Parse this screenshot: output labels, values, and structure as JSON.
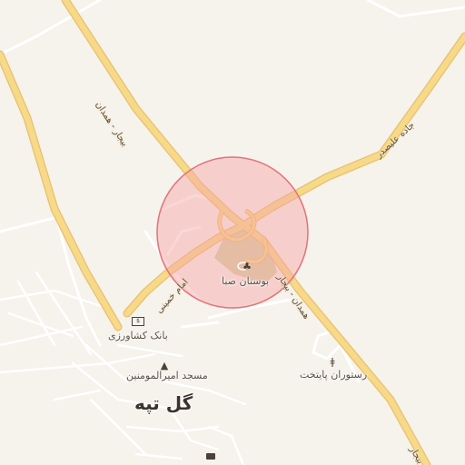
{
  "map": {
    "colors": {
      "background": "#f6f2ec",
      "major_road": "#f7d98a",
      "major_road_casing": "#e8c06a",
      "minor_road": "#ffffff",
      "park": "#d8cfa3",
      "highlight_fill": "#f6a4a6",
      "highlight_stroke": "#e4727a"
    },
    "places": {
      "town": "گل تپه",
      "park": "بوستان صبا",
      "bank": "بانک کشاورزی",
      "mosque": "مسجد امیرالمومنین",
      "restaurant": "رستوران پایتخت"
    },
    "roads": {
      "bijar_hamedan_north": "بیجار - همدان",
      "hamedan_bijar_south": "همدان - بیجار",
      "jadeh_alisadr": "جاده علیصدر",
      "imam_khomeini": "امام خمینی",
      "edge_label": "بیجار"
    },
    "icons": {
      "park": "tree-icon",
      "bank": "bank-icon",
      "mosque": "mosque-icon",
      "restaurant": "restaurant-icon",
      "post": "mail-icon"
    }
  }
}
